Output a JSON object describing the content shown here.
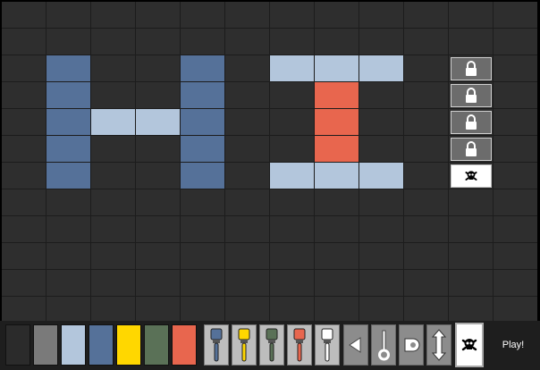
{
  "board": {
    "columns": 12,
    "rows": 12,
    "colors": {
      "empty": "#2e2e2e",
      "blue": "#557199",
      "light": "#b3c6dc",
      "red": "#e8664e",
      "gridline": "#1c1c1c"
    },
    "cells": [
      {
        "row": 2,
        "col": 1,
        "type": "blue"
      },
      {
        "row": 3,
        "col": 1,
        "type": "blue"
      },
      {
        "row": 4,
        "col": 1,
        "type": "blue"
      },
      {
        "row": 5,
        "col": 1,
        "type": "blue"
      },
      {
        "row": 6,
        "col": 1,
        "type": "blue"
      },
      {
        "row": 4,
        "col": 2,
        "type": "light"
      },
      {
        "row": 4,
        "col": 3,
        "type": "light"
      },
      {
        "row": 2,
        "col": 4,
        "type": "blue"
      },
      {
        "row": 3,
        "col": 4,
        "type": "blue"
      },
      {
        "row": 4,
        "col": 4,
        "type": "blue"
      },
      {
        "row": 5,
        "col": 4,
        "type": "blue"
      },
      {
        "row": 6,
        "col": 4,
        "type": "blue"
      },
      {
        "row": 2,
        "col": 6,
        "type": "light"
      },
      {
        "row": 2,
        "col": 7,
        "type": "light"
      },
      {
        "row": 2,
        "col": 8,
        "type": "light"
      },
      {
        "row": 3,
        "col": 7,
        "type": "red"
      },
      {
        "row": 4,
        "col": 7,
        "type": "red"
      },
      {
        "row": 5,
        "col": 7,
        "type": "red"
      },
      {
        "row": 6,
        "col": 6,
        "type": "light"
      },
      {
        "row": 6,
        "col": 7,
        "type": "light"
      },
      {
        "row": 6,
        "col": 8,
        "type": "light"
      },
      {
        "row": 2,
        "col": 10,
        "type": "lock"
      },
      {
        "row": 3,
        "col": 10,
        "type": "lock"
      },
      {
        "row": 4,
        "col": 10,
        "type": "lock"
      },
      {
        "row": 5,
        "col": 10,
        "type": "lock"
      },
      {
        "row": 6,
        "col": 10,
        "type": "skull"
      }
    ]
  },
  "toolbar": {
    "swatches": [
      {
        "name": "swatch-black",
        "color": "#2b2b2b"
      },
      {
        "name": "swatch-gray",
        "color": "#7a7a7a"
      },
      {
        "name": "swatch-light-blue",
        "color": "#b3c6dc"
      },
      {
        "name": "swatch-blue",
        "color": "#557199"
      },
      {
        "name": "swatch-yellow",
        "color": "#ffd700"
      },
      {
        "name": "swatch-green",
        "color": "#5a7157"
      },
      {
        "name": "swatch-red",
        "color": "#e8664e"
      }
    ],
    "brushes": [
      {
        "name": "blue-brush-icon",
        "color": "#557199"
      },
      {
        "name": "yellow-brush-icon",
        "color": "#ffd700"
      },
      {
        "name": "green-brush-icon",
        "color": "#5a7157"
      },
      {
        "name": "red-brush-icon",
        "color": "#e8664e"
      },
      {
        "name": "white-brush-icon",
        "color": "#ffffff"
      }
    ],
    "tools": [
      {
        "name": "arrow-left-icon"
      },
      {
        "name": "key-icon"
      },
      {
        "name": "plug-icon"
      },
      {
        "name": "vertical-arrows-icon"
      },
      {
        "name": "skull-icon"
      }
    ],
    "play_label": "Play!"
  }
}
